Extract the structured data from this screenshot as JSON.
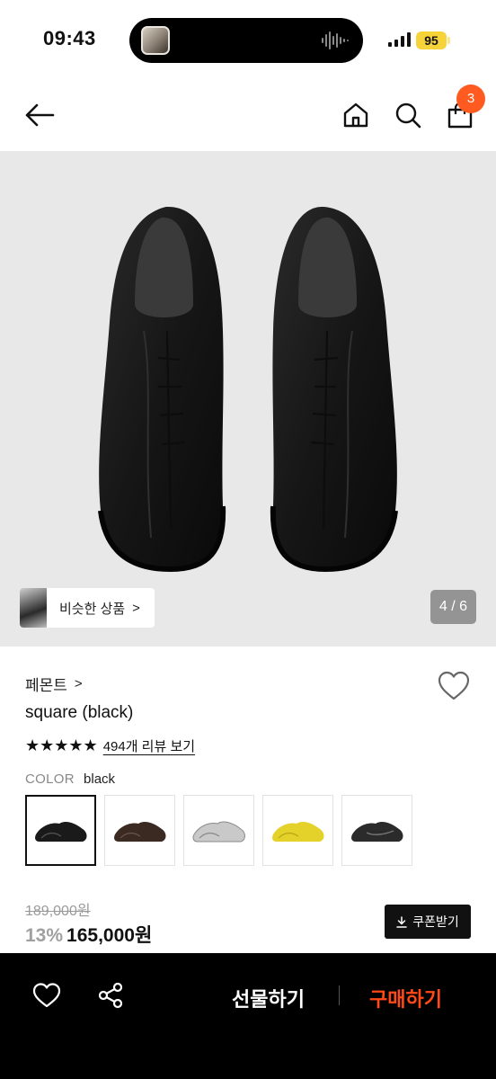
{
  "status_bar": {
    "time": "09:43",
    "battery": "95"
  },
  "header": {
    "cart_count": "3"
  },
  "hero": {
    "similar_label": "비슷한 상품",
    "similar_arrow": ">",
    "page_indicator": "4 / 6"
  },
  "product": {
    "brand": "페몬트",
    "brand_chevron": ">",
    "name": "square (black)",
    "stars": "★★★★★",
    "review_link": "494개 리뷰 보기",
    "color_key": "COLOR",
    "color_value": "black",
    "swatches": [
      {
        "color": "#1a1a1a"
      },
      {
        "color": "#3b2a22"
      },
      {
        "color": "#c9c9c9"
      },
      {
        "color": "#e4d12a"
      },
      {
        "color": "#2b2b2b"
      }
    ],
    "original_price": "189,000원",
    "discount": "13%",
    "price": "165,000원",
    "coupon_label": "쿠폰받기"
  },
  "bottom_bar": {
    "gift_label": "선물하기",
    "buy_label": "구매하기"
  },
  "colors": {
    "accent": "#ff4a17",
    "badge": "#ff5a1f"
  }
}
